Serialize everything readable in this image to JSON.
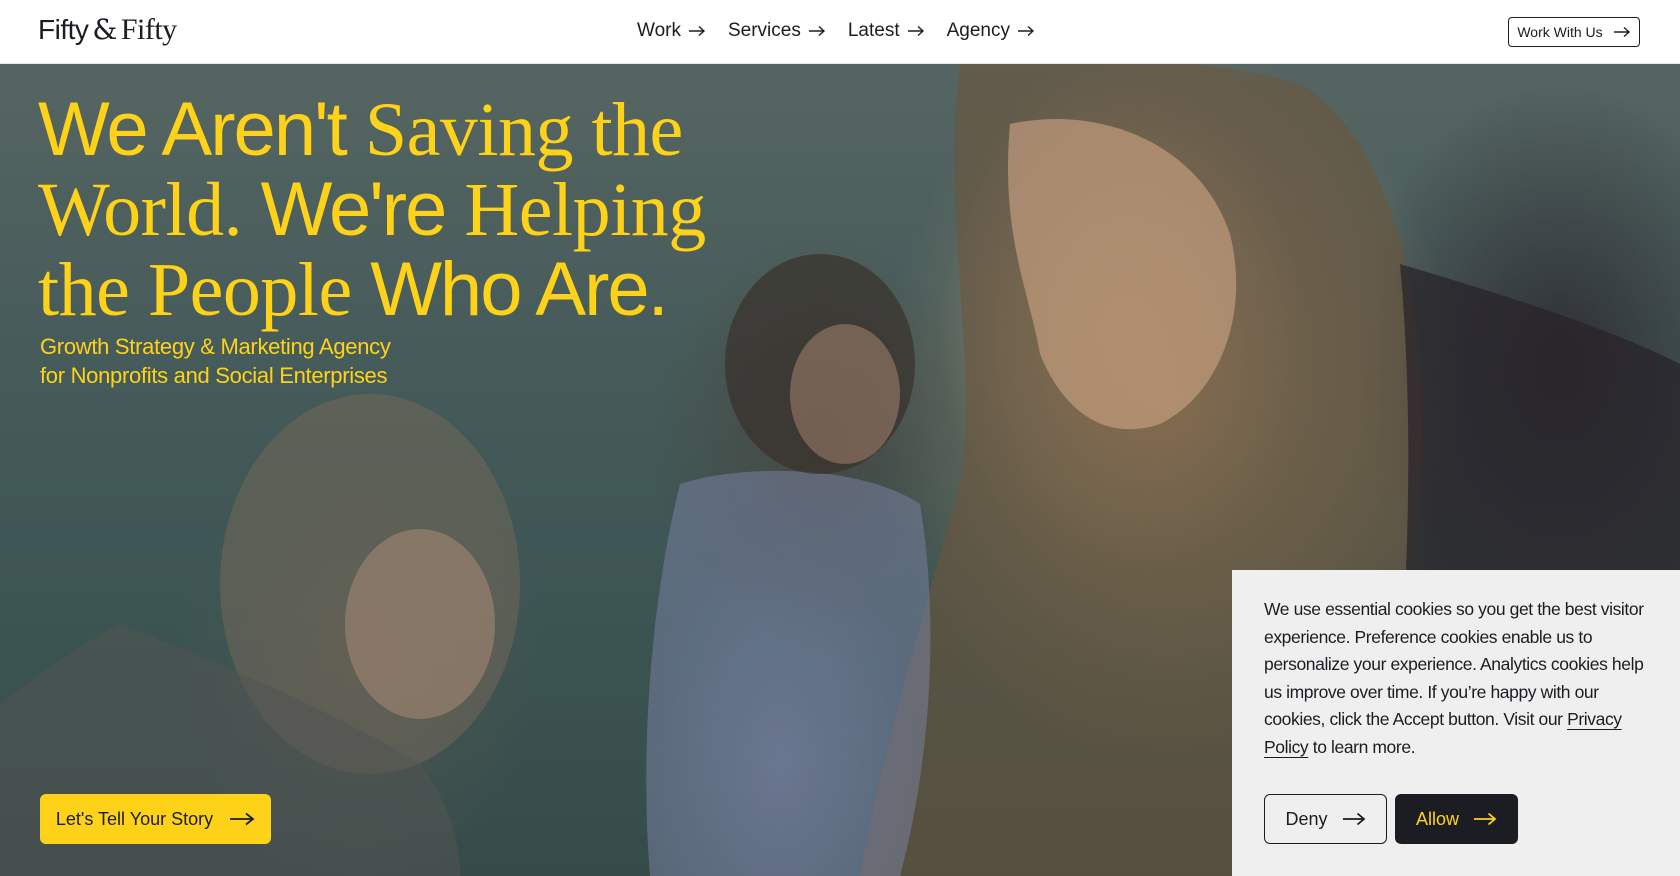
{
  "header": {
    "logo": {
      "part1": "Fifty",
      "amp": "&",
      "part2": "Fifty"
    },
    "nav": [
      {
        "label": "Work"
      },
      {
        "label": "Services"
      },
      {
        "label": "Latest"
      },
      {
        "label": "Agency"
      }
    ],
    "cta_label": "Work With Us",
    "arrow_icon": "arrow-right-icon"
  },
  "hero": {
    "headline": {
      "line1_a": "We Aren't ",
      "line1_b": "Saving the",
      "line2_a": "World. ",
      "line2_b": "We're ",
      "line2_c": "Helping",
      "line3_a": "the People ",
      "line3_b": "Who Are."
    },
    "subhead_line1": "Growth Strategy & Marketing Agency",
    "subhead_line2": "for Nonprofits and Social Enterprises",
    "button_label": "Let's Tell Your Story",
    "accent_color": "#ffd21a"
  },
  "cookie": {
    "text_before_link": "We use essential cookies so you get the best visitor experience. Preference cookies enable us to personalize your experience. Analytics cookies help us improve over time. If you’re happy with our cookies, click the Accept button. Visit our ",
    "link_text": "Privacy Policy",
    "text_after_link": " to learn more.",
    "deny_label": "Deny",
    "allow_label": "Allow"
  },
  "colors": {
    "text_dark": "#1b1d22",
    "cookie_bg": "#efefef",
    "yellow": "#ffd21a"
  }
}
